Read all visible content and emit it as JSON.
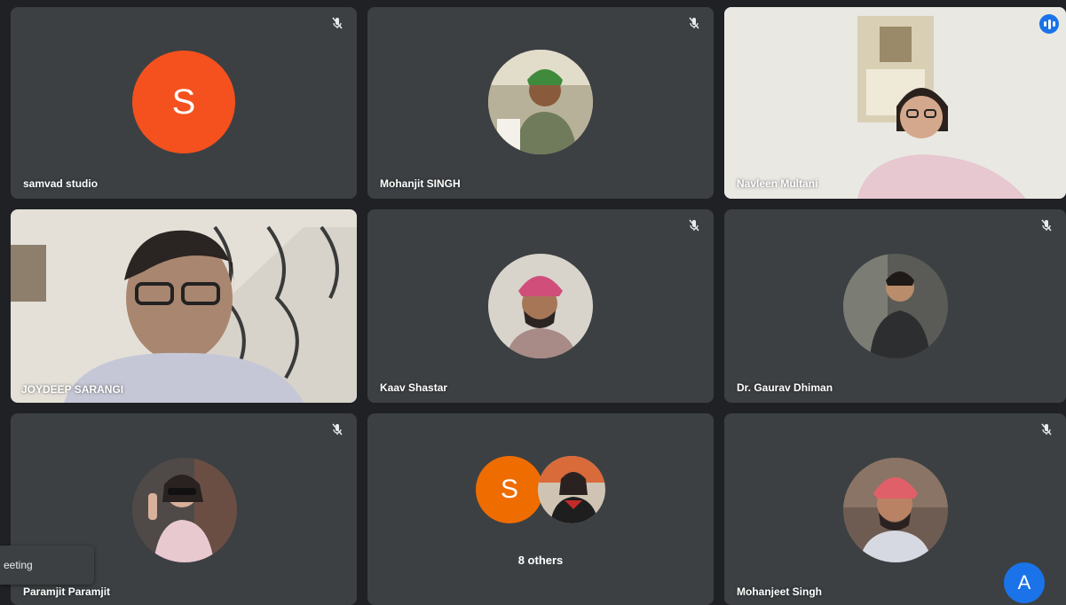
{
  "colors": {
    "tile_bg": "#3c4043",
    "samvad_avatar": "#f4511e",
    "others_avatar": "#ef6c00",
    "active_speaker": "#1a73e8",
    "account": "#1a73e8"
  },
  "participants": [
    {
      "name": "samvad studio",
      "initial": "S",
      "muted": true
    },
    {
      "name": "Mohanjit SINGH",
      "muted": true
    },
    {
      "name": "Navleen Multani",
      "muted": false,
      "speaking": true
    },
    {
      "name": "JOYDEEP SARANGI",
      "muted": true
    },
    {
      "name": "Kaav Shastar",
      "muted": true
    },
    {
      "name": "Dr. Gaurav Dhiman",
      "muted": true
    },
    {
      "name": "Paramjit Paramjit",
      "muted": true
    },
    {
      "name": "Mohanjeet Singh",
      "muted": true
    }
  ],
  "others_tile": {
    "label": "8 others",
    "initial": "S"
  },
  "toast": {
    "text": "eeting"
  },
  "account": {
    "initial": "A"
  }
}
